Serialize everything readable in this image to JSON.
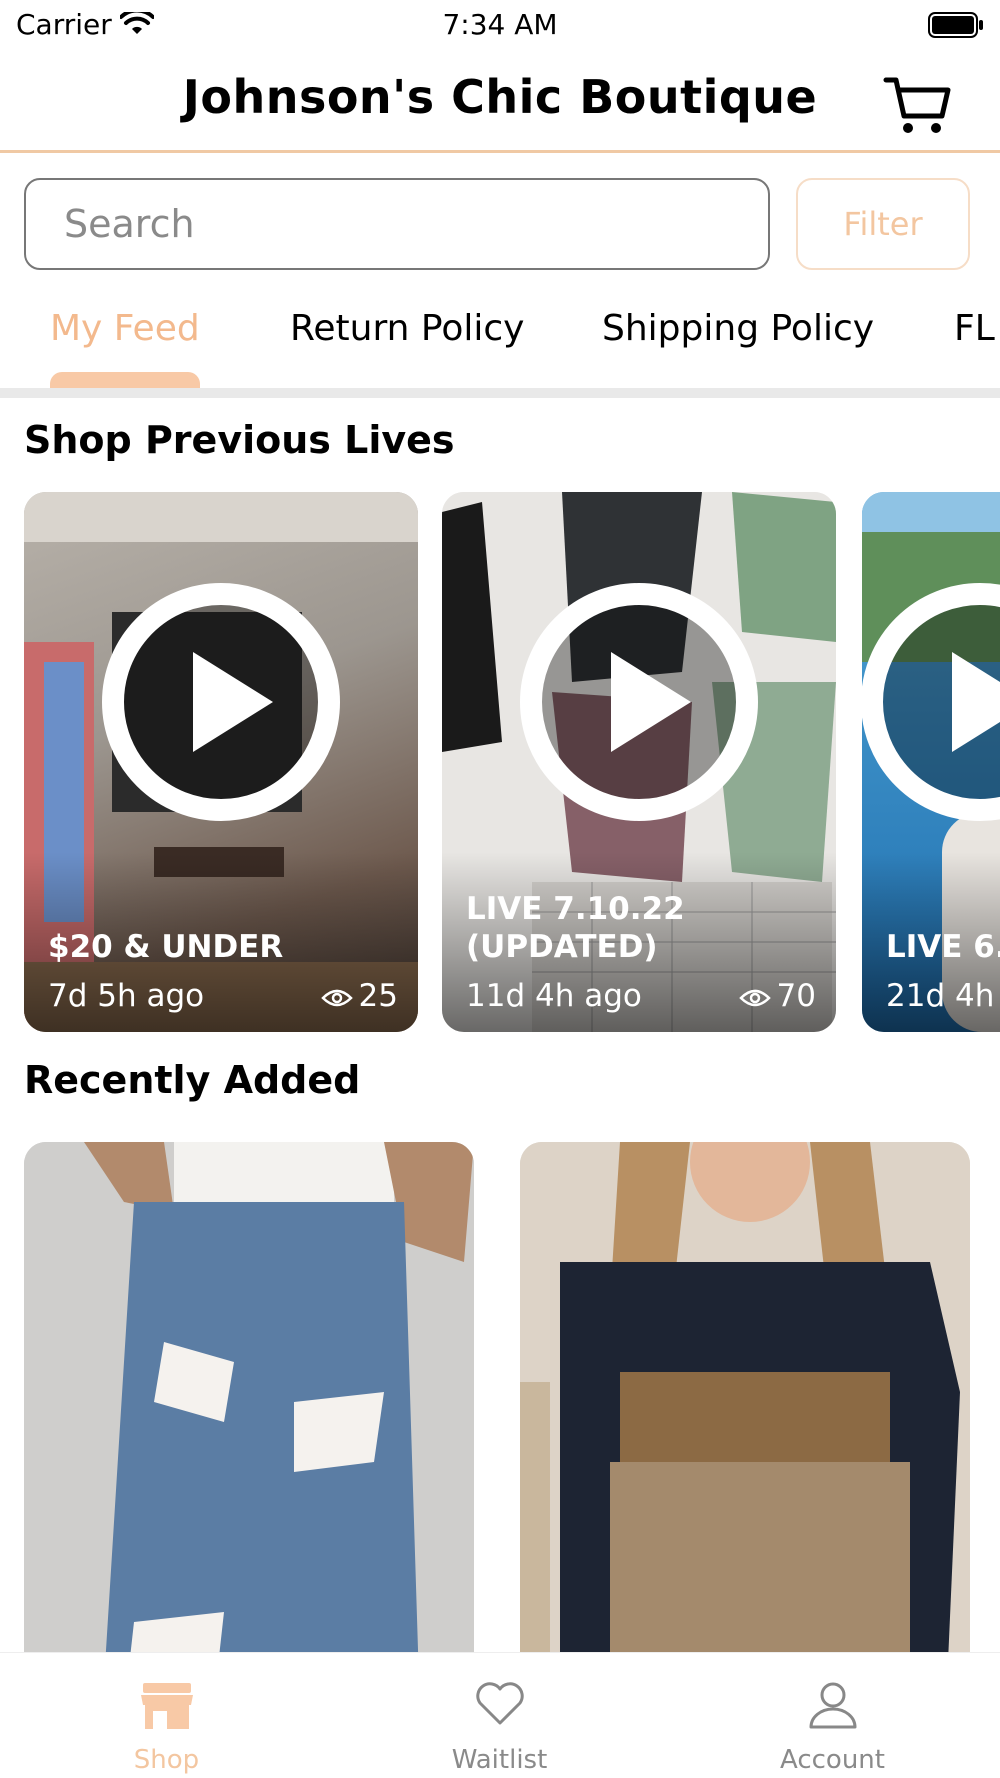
{
  "status_bar": {
    "carrier": "Carrier",
    "time": "7:34 AM"
  },
  "header": {
    "title": "Johnson's Chic Boutique"
  },
  "search": {
    "placeholder": "Search",
    "filter_label": "Filter"
  },
  "tabs": [
    {
      "label": "My Feed",
      "active": true
    },
    {
      "label": "Return Policy",
      "active": false
    },
    {
      "label": "Shipping Policy",
      "active": false
    },
    {
      "label": "FL",
      "active": false
    }
  ],
  "sections": {
    "previous_lives": "Shop Previous Lives",
    "recently_added": "Recently Added"
  },
  "lives": [
    {
      "name": "$20 & UNDER",
      "ago": "7d 5h ago",
      "views": "25"
    },
    {
      "name": "LIVE 7.10.22 (UPDATED)",
      "ago": "11d 4h ago",
      "views": "70"
    },
    {
      "name": "LIVE 6.",
      "ago": "21d 4h",
      "views": ""
    }
  ],
  "bottom_nav": [
    {
      "label": "Shop",
      "active": true
    },
    {
      "label": "Waitlist",
      "active": false
    },
    {
      "label": "Account",
      "active": false
    }
  ],
  "colors": {
    "accent": "#f3b98d",
    "accent_light": "#f8c9a6"
  }
}
